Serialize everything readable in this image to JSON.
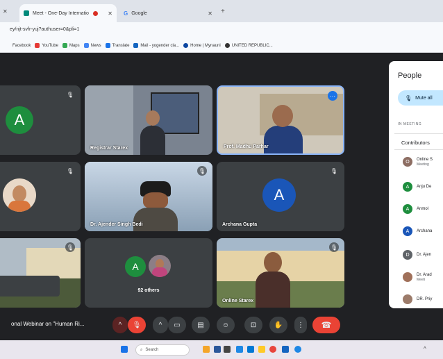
{
  "browser": {
    "tabs": [
      {
        "label": "Meet - One-Day Internatio",
        "active": true
      },
      {
        "label": "Google",
        "active": false
      }
    ],
    "url": "ey/njt-svfr-yuj?authuser=0&pli=1",
    "bookmarks": [
      "Facebook",
      "YouTube",
      "Maps",
      "News",
      "Translate",
      "Mail - yogender cla...",
      "Home | Mynauni",
      "UNITED REPUBLIC..."
    ]
  },
  "meet": {
    "tiles": [
      {
        "name": "",
        "avatar": "A",
        "avatar_color": "#1e8e3e"
      },
      {
        "name": "Registrar Starex"
      },
      {
        "name": "Prof. Madhu Parhar"
      },
      {
        "name": ""
      },
      {
        "name": "Dr. Ajender Singh Bedi"
      },
      {
        "name": "Archana Gupta",
        "avatar": "A",
        "avatar_color": "#1a56b8"
      },
      {
        "name": ""
      },
      {
        "name": "92 others",
        "avatar": "A",
        "avatar_color": "#1e8e3e"
      },
      {
        "name": "Online Starex"
      }
    ],
    "meeting_title": "onal Webinar on \"Human Ri..."
  },
  "people": {
    "title": "People",
    "mute_all": "Mute all",
    "in_meeting": "IN MEETING",
    "contributors": "Contributors",
    "list": [
      {
        "initial": "O",
        "name": "Online S",
        "sub": "Meeting",
        "color": "#8d6e63"
      },
      {
        "initial": "A",
        "name": "Anju De",
        "sub": "",
        "color": "#1e8e3e"
      },
      {
        "initial": "A",
        "name": "Anmol",
        "sub": "",
        "color": "#1e8e3e"
      },
      {
        "initial": "A",
        "name": "Archana",
        "sub": "",
        "color": "#1a56b8"
      },
      {
        "initial": "D",
        "name": "Dr. Ajen",
        "sub": "",
        "color": "#5f6368"
      },
      {
        "initial": "",
        "name": "Dr. Arad",
        "sub": "Meeti",
        "color": "#a0705a"
      },
      {
        "initial": "",
        "name": "DR. Priy",
        "sub": "",
        "color": "#9c7b6a"
      }
    ]
  },
  "taskbar": {
    "search": "Search"
  }
}
